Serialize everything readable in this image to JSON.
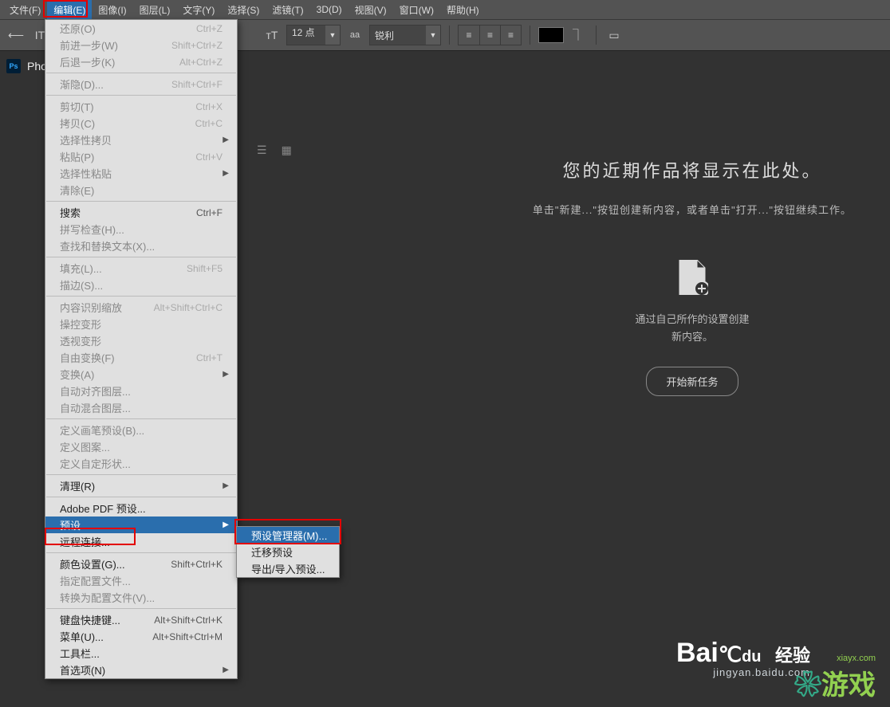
{
  "menubar": {
    "items": [
      "文件(F)",
      "编辑(E)",
      "图像(I)",
      "图层(L)",
      "文字(Y)",
      "选择(S)",
      "滤镜(T)",
      "3D(D)",
      "视图(V)",
      "窗口(W)",
      "帮助(H)"
    ],
    "active_index": 1
  },
  "toolbar": {
    "font_size": "12 点",
    "aa_label": "aa",
    "antialias": "锐利"
  },
  "app_title": "Phot",
  "welcome": {
    "title": "您的近期作品将显示在此处。",
    "subtitle": "单击\"新建...\"按钮创建新内容，或者单击\"打开...\"按钮继续工作。",
    "desc1": "通过自己所作的设置创建",
    "desc2": "新内容。",
    "button": "开始新任务"
  },
  "edit_menu": {
    "groups": [
      [
        {
          "label": "还原(O)",
          "shortcut": "Ctrl+Z",
          "disabled": true
        },
        {
          "label": "前进一步(W)",
          "shortcut": "Shift+Ctrl+Z",
          "disabled": true
        },
        {
          "label": "后退一步(K)",
          "shortcut": "Alt+Ctrl+Z",
          "disabled": true
        }
      ],
      [
        {
          "label": "渐隐(D)...",
          "shortcut": "Shift+Ctrl+F",
          "disabled": true
        }
      ],
      [
        {
          "label": "剪切(T)",
          "shortcut": "Ctrl+X",
          "disabled": true
        },
        {
          "label": "拷贝(C)",
          "shortcut": "Ctrl+C",
          "disabled": true
        },
        {
          "label": "选择性拷贝",
          "submenu": true,
          "disabled": true
        },
        {
          "label": "粘贴(P)",
          "shortcut": "Ctrl+V",
          "disabled": true
        },
        {
          "label": "选择性粘贴",
          "submenu": true,
          "disabled": true
        },
        {
          "label": "清除(E)",
          "disabled": true
        }
      ],
      [
        {
          "label": "搜索",
          "shortcut": "Ctrl+F"
        },
        {
          "label": "拼写检查(H)...",
          "disabled": true
        },
        {
          "label": "查找和替换文本(X)...",
          "disabled": true
        }
      ],
      [
        {
          "label": "填充(L)...",
          "shortcut": "Shift+F5",
          "disabled": true
        },
        {
          "label": "描边(S)...",
          "disabled": true
        }
      ],
      [
        {
          "label": "内容识别缩放",
          "shortcut": "Alt+Shift+Ctrl+C",
          "disabled": true
        },
        {
          "label": "操控变形",
          "disabled": true
        },
        {
          "label": "透视变形",
          "disabled": true
        },
        {
          "label": "自由变换(F)",
          "shortcut": "Ctrl+T",
          "disabled": true
        },
        {
          "label": "变换(A)",
          "submenu": true,
          "disabled": true
        },
        {
          "label": "自动对齐图层...",
          "disabled": true
        },
        {
          "label": "自动混合图层...",
          "disabled": true
        }
      ],
      [
        {
          "label": "定义画笔预设(B)...",
          "disabled": true
        },
        {
          "label": "定义图案...",
          "disabled": true
        },
        {
          "label": "定义自定形状...",
          "disabled": true
        }
      ],
      [
        {
          "label": "清理(R)",
          "submenu": true
        }
      ],
      [
        {
          "label": "Adobe PDF 预设..."
        },
        {
          "label": "预设",
          "submenu": true,
          "highlighted": true
        },
        {
          "label": "远程连接..."
        }
      ],
      [
        {
          "label": "颜色设置(G)...",
          "shortcut": "Shift+Ctrl+K"
        },
        {
          "label": "指定配置文件...",
          "disabled": true
        },
        {
          "label": "转换为配置文件(V)...",
          "disabled": true
        }
      ],
      [
        {
          "label": "键盘快捷键...",
          "shortcut": "Alt+Shift+Ctrl+K"
        },
        {
          "label": "菜单(U)...",
          "shortcut": "Alt+Shift+Ctrl+M"
        },
        {
          "label": "工具栏..."
        },
        {
          "label": "首选项(N)",
          "submenu": true
        }
      ]
    ]
  },
  "submenu": {
    "items": [
      {
        "label": "预设管理器(M)...",
        "highlighted": true
      },
      {
        "label": "迁移预设"
      },
      {
        "label": "导出/导入预设..."
      }
    ]
  },
  "watermark": {
    "brand": "Bai",
    "brand2": "du",
    "brand3": "经验",
    "site": "jingyan.baidu.com",
    "logo2": "游戏",
    "logo2_url": "xiayx.com"
  }
}
